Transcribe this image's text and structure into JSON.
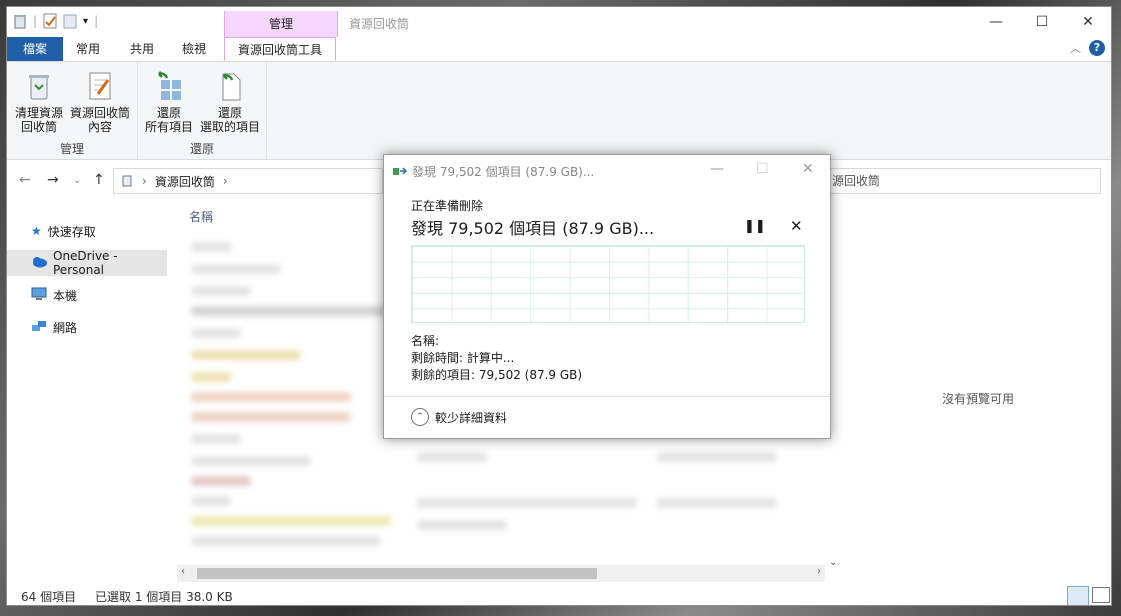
{
  "title_bar": {
    "context_tab_label": "管理",
    "title": "資源回收筒",
    "minimize": "—",
    "maximize": "☐",
    "close": "✕"
  },
  "tabs": {
    "file": "檔案",
    "home": "常用",
    "share": "共用",
    "view": "檢視",
    "recycle_tools": "資源回收筒工具"
  },
  "ribbon": {
    "empty_recycle_bin": "清理資源\n回收筒",
    "recycle_bin_properties": "資源回收筒\n內容",
    "group_manage": "管理",
    "restore_all": "還原\n所有項目",
    "restore_selected": "還原\n選取的項目",
    "group_restore": "還原"
  },
  "address": {
    "path": "資源回收筒",
    "search_partial": "源回收筒"
  },
  "nav_pane": {
    "quick_access": "快速存取",
    "onedrive": "OneDrive - Personal",
    "this_pc": "本機",
    "network": "網路"
  },
  "content": {
    "column_name": "名稱",
    "no_preview": "沒有預覽可用"
  },
  "status_bar": {
    "item_count": "64 個項目",
    "selected": "已選取 1 個項目  38.0 KB"
  },
  "dialog": {
    "title": "發現 79,502 個項目 (87.9 GB)...",
    "subtitle": "正在準備刪除",
    "main": "發現 79,502 個項目 (87.9 GB)...",
    "name_label": "名稱:",
    "time_remaining": "剩餘時間: 計算中...",
    "items_remaining": "剩餘的項目: 79,502 (87.9 GB)",
    "fewer_details": "較少詳細資料",
    "pause_icon": "pause-icon",
    "stop_icon": "close-icon"
  },
  "colors": {
    "file_tab": "#1f5fa8",
    "context_tab": "#f5d7ff",
    "graph_grid": "#d8efea"
  }
}
